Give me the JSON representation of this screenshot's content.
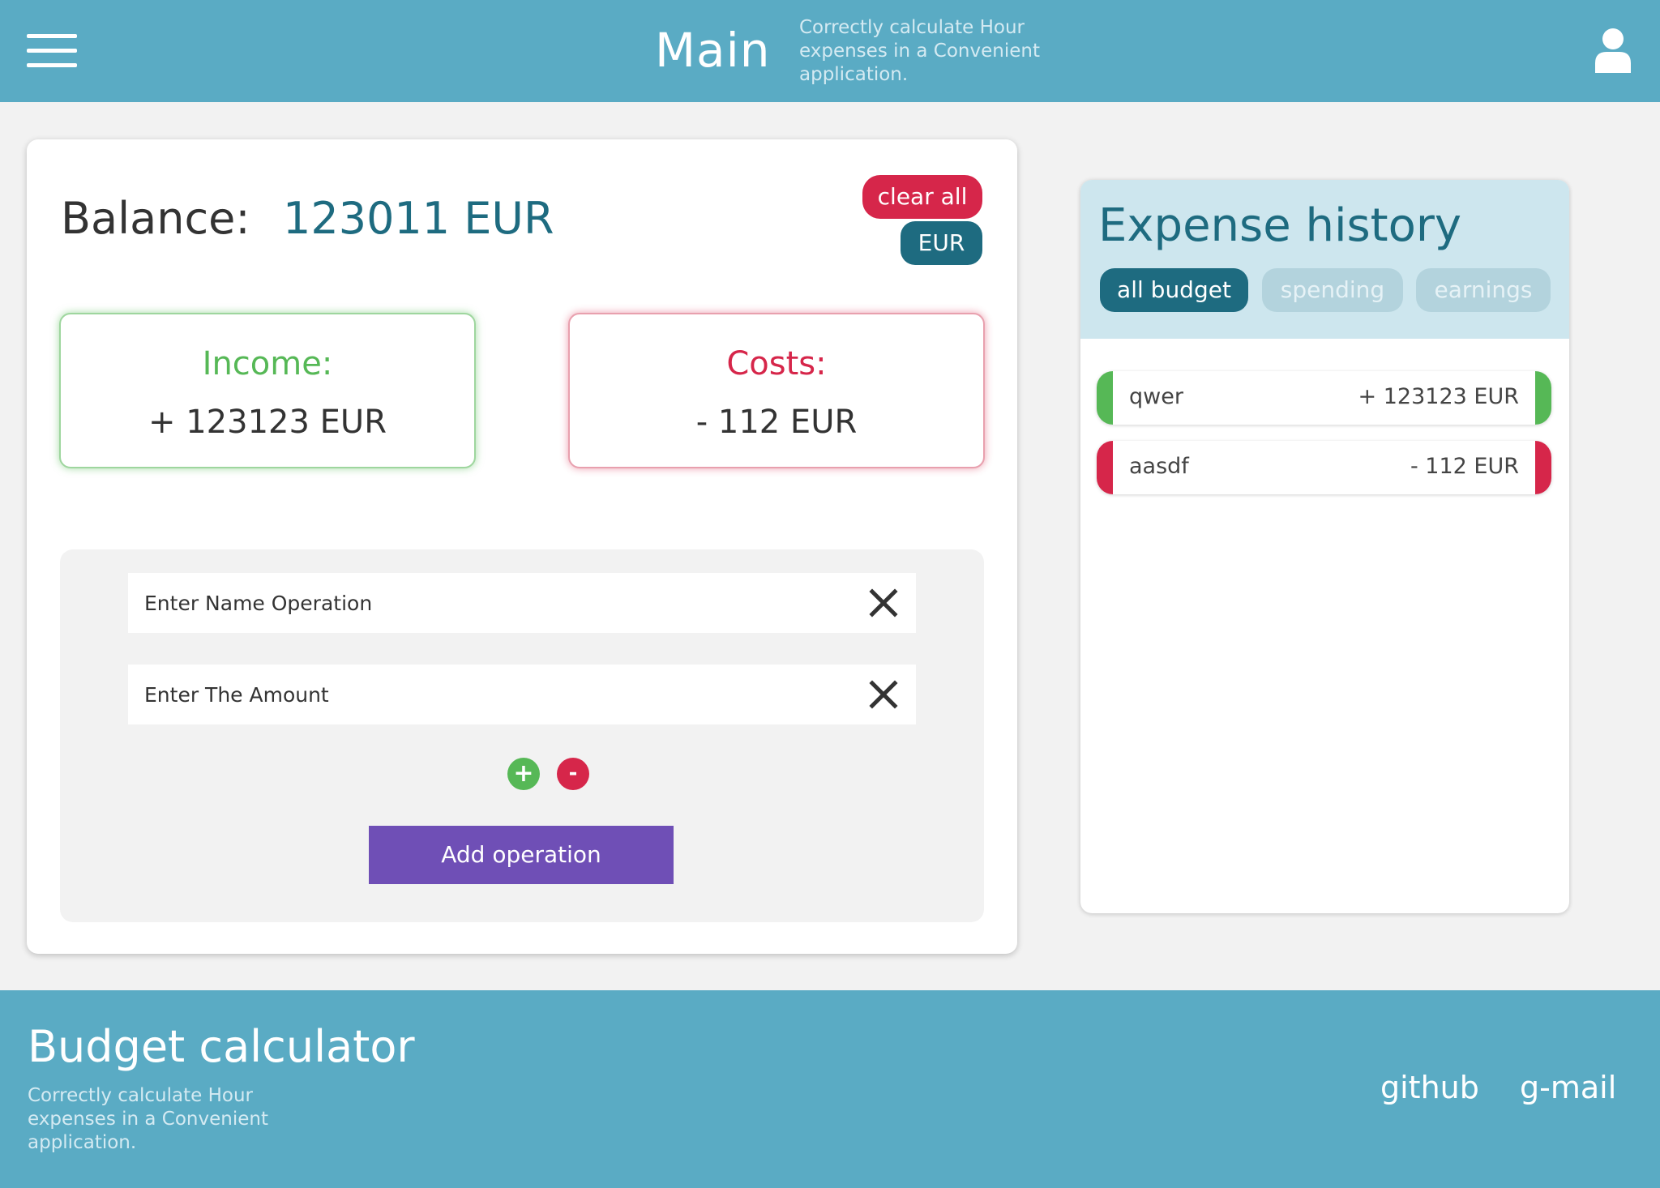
{
  "header": {
    "title": "Main",
    "subtitle": "Correctly calculate Hour expenses in a Convenient application."
  },
  "balance": {
    "label": "Balance:",
    "value": "123011 EUR",
    "clear_label": "clear all",
    "currency_label": "EUR"
  },
  "income": {
    "label": "Income:",
    "value": "+ 123123 EUR"
  },
  "costs": {
    "label": "Costs:",
    "value": "- 112 EUR"
  },
  "form": {
    "name_placeholder": "Enter Name Operation",
    "amount_placeholder": "Enter The Amount",
    "plus_label": "+",
    "minus_label": "-",
    "add_label": "Add operation"
  },
  "history": {
    "title": "Expense history",
    "filters": [
      "all budget",
      "spending",
      "earnings"
    ],
    "active_filter": "all budget",
    "items": [
      {
        "name": "qwer",
        "amount": "+  123123 EUR",
        "type": "income"
      },
      {
        "name": "aasdf",
        "amount": "-  112 EUR",
        "type": "cost"
      }
    ]
  },
  "footer": {
    "title": "Budget calculator",
    "subtitle": "Correctly calculate Hour expenses in a Convenient application.",
    "links": [
      "github",
      "g-mail"
    ]
  },
  "colors": {
    "header_bg": "#5aabc4",
    "accent_dark": "#1e6b80",
    "income_green": "#56b856",
    "cost_red": "#d6264a",
    "add_purple": "#6f4fb6"
  },
  "icons": {
    "menu": "hamburger-menu-icon",
    "user": "user-icon",
    "clear": "close-icon"
  }
}
